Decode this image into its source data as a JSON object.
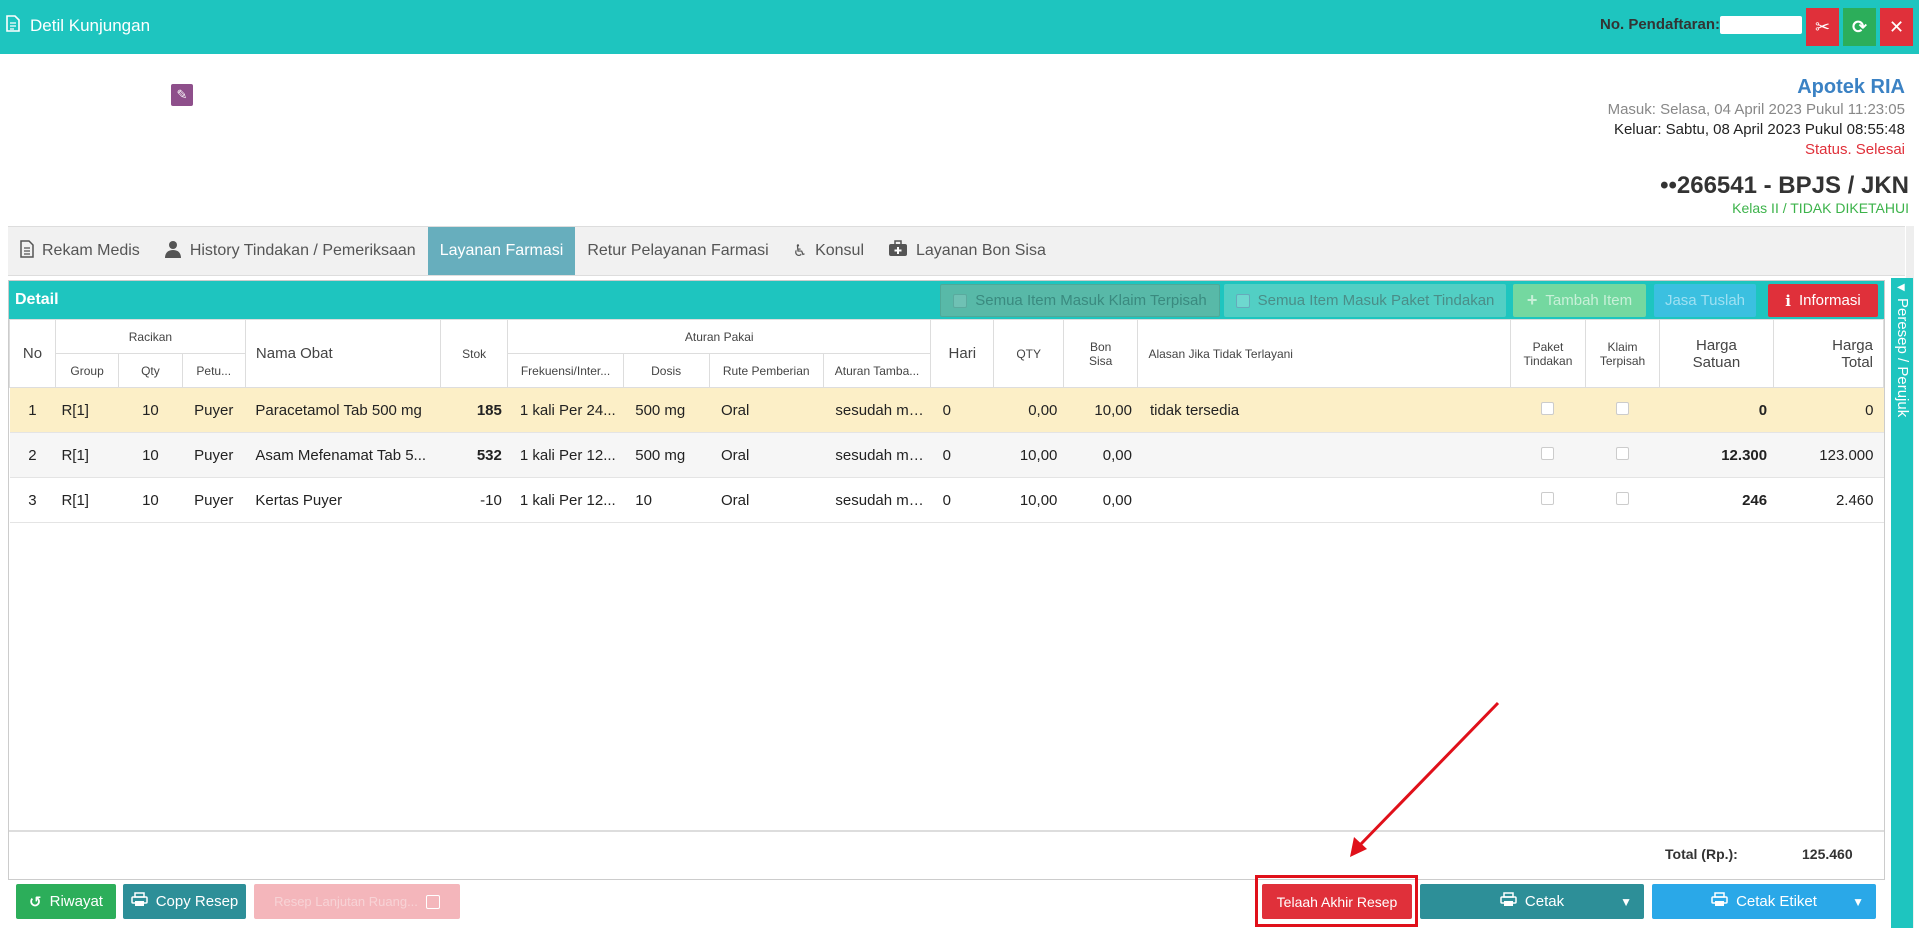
{
  "window": {
    "title": "Detil Kunjungan",
    "registration_label": "No. Pendaftaran:"
  },
  "header": {
    "apotek": "Apotek RIA",
    "masuk": "Masuk: Selasa, 04 April 2023 Pukul 11:23:05",
    "keluar": "Keluar: Sabtu, 08 April 2023 Pukul 08:55:48",
    "status": "Status. Selesai",
    "patient_id": "••266541 - BPJS / JKN",
    "kelas": "Kelas II / TIDAK DIKETAHUI"
  },
  "tabs": [
    {
      "label": "Rekam Medis",
      "icon": "document-icon"
    },
    {
      "label": "History Tindakan / Pemeriksaan",
      "icon": "doctor-icon"
    },
    {
      "label": "Layanan Farmasi",
      "icon": "",
      "active": true
    },
    {
      "label": "Retur Pelayanan Farmasi",
      "icon": ""
    },
    {
      "label": "Konsul",
      "icon": "wheelchair-icon"
    },
    {
      "label": "Layanan Bon Sisa",
      "icon": "medkit-icon"
    }
  ],
  "panel": {
    "title": "Detail",
    "btn_klaim": "Semua Item Masuk Klaim Terpisah",
    "btn_paket": "Semua Item Masuk Paket Tindakan",
    "btn_tambah": "Tambah Item",
    "btn_jasa": "Jasa Tuslah",
    "btn_info": "Informasi"
  },
  "columns": {
    "no": "No",
    "racikan": "Racikan",
    "group": "Group",
    "qty": "Qty",
    "petu": "Petu...",
    "nama_obat": "Nama Obat",
    "stok": "Stok",
    "aturan_pakai": "Aturan Pakai",
    "frekuensi": "Frekuensi/Inter...",
    "dosis": "Dosis",
    "rute": "Rute Pemberian",
    "aturan_tambahan": "Aturan Tamba...",
    "hari": "Hari",
    "qty2": "QTY",
    "bon_sisa_1": "Bon",
    "bon_sisa_2": "Sisa",
    "alasan": "Alasan Jika Tidak Terlayani",
    "paket_1": "Paket",
    "paket_2": "Tindakan",
    "klaim_1": "Klaim",
    "klaim_2": "Terpisah",
    "harga_satuan_1": "Harga",
    "harga_satuan_2": "Satuan",
    "harga_total_1": "Harga",
    "harga_total_2": "Total"
  },
  "rows": [
    {
      "no": "1",
      "group": "R[1]",
      "qty": "10",
      "petu": "Puyer",
      "nama": "Paracetamol Tab 500 mg",
      "stok": "185",
      "frek": "1 kali Per 24...",
      "dosis": "500 mg",
      "rute": "Oral",
      "aturan": "sesudah ma...",
      "hari": "0",
      "qty2": "0,00",
      "bon": "10,00",
      "alasan": "tidak tersedia",
      "satuan": "0",
      "total": "0"
    },
    {
      "no": "2",
      "group": "R[1]",
      "qty": "10",
      "petu": "Puyer",
      "nama": "Asam Mefenamat Tab 5...",
      "stok": "532",
      "frek": "1 kali Per 12...",
      "dosis": "500 mg",
      "rute": "Oral",
      "aturan": "sesudah ma...",
      "hari": "0",
      "qty2": "10,00",
      "bon": "0,00",
      "alasan": "",
      "satuan": "12.300",
      "total": "123.000"
    },
    {
      "no": "3",
      "group": "R[1]",
      "qty": "10",
      "petu": "Puyer",
      "nama": "Kertas Puyer",
      "stok": "-10",
      "frek": "1 kali Per 12...",
      "dosis": "10",
      "rute": "Oral",
      "aturan": "sesudah ma...",
      "hari": "0",
      "qty2": "10,00",
      "bon": "0,00",
      "alasan": "",
      "satuan": "246",
      "total": "2.460"
    }
  ],
  "total": {
    "label": "Total (Rp.):",
    "value": "125.460"
  },
  "bottom": {
    "riwayat": "Riwayat",
    "copy_resep": "Copy Resep",
    "disabled_btn": "Resep Lanjutan Ruang...",
    "telaah": "Telaah Akhir Resep",
    "cetak": "Cetak",
    "cetak_etiket": "Cetak Etiket"
  },
  "side_tab": "Peresep / Perujuk",
  "colors": {
    "teal": "#1ec5bf",
    "red": "#e0303a",
    "blue": "#3b82c4",
    "green": "#3cb34a"
  }
}
